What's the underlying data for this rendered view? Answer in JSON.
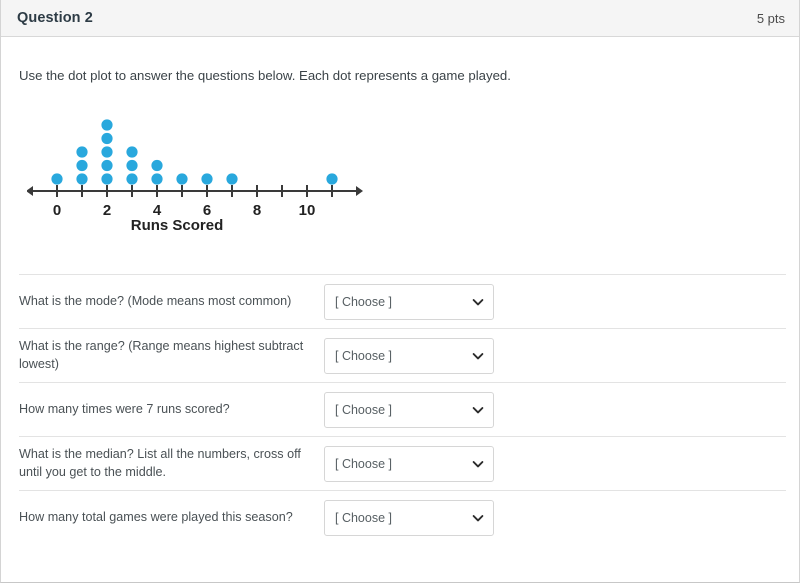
{
  "header": {
    "title": "Question 2",
    "points": "5 pts"
  },
  "prompt": "Use the dot plot to answer the questions below. Each dot represents a game played.",
  "chart_data": {
    "type": "dot_plot",
    "title": "",
    "xlabel": "Runs Scored",
    "ylabel": "",
    "categories": [
      0,
      1,
      2,
      3,
      4,
      5,
      6,
      7,
      8,
      9,
      10,
      11
    ],
    "values": [
      1,
      3,
      5,
      3,
      2,
      1,
      1,
      1,
      0,
      0,
      0,
      1
    ],
    "tick_labels_shown": [
      "0",
      "2",
      "4",
      "6",
      "8",
      "10"
    ],
    "axis_range": [
      0,
      11
    ],
    "dot_color": "#29a8dd",
    "axis_color": "#3a3a3a",
    "total_dots": 18,
    "grid": false,
    "legend": null,
    "annotations": []
  },
  "questions": [
    {
      "label": "What is the mode? (Mode means most common)",
      "selected": "[ Choose ]"
    },
    {
      "label": "What is the range? (Range means highest subtract lowest)",
      "selected": "[ Choose ]"
    },
    {
      "label": "How many times were 7 runs scored?",
      "selected": "[ Choose ]"
    },
    {
      "label": "What is the median? List all the numbers, cross off until you get to the middle.",
      "selected": "[ Choose ]"
    },
    {
      "label": "How many total games were played this season?",
      "selected": "[ Choose ]"
    }
  ]
}
